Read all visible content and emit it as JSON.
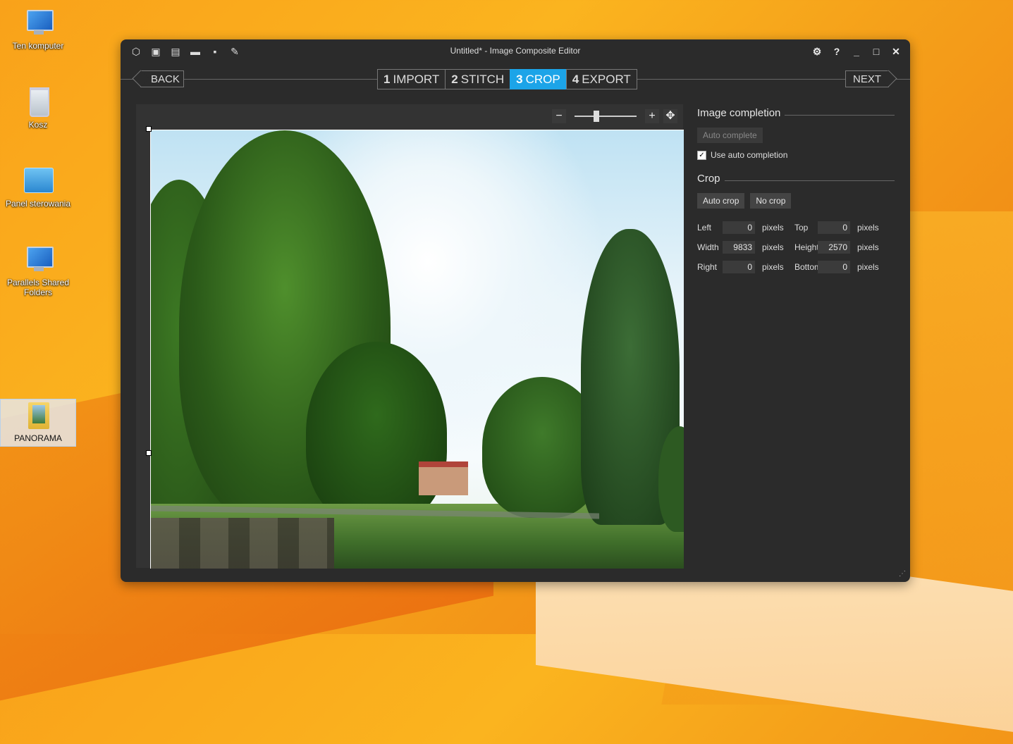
{
  "desktop": {
    "icons": [
      {
        "label": "Ten komputer"
      },
      {
        "label": "Kosz"
      },
      {
        "label": "Panel sterowania"
      },
      {
        "label": "Parallels Shared Folders"
      },
      {
        "label": "PANORAMA"
      }
    ]
  },
  "window": {
    "title": "Untitled* - Image Composite Editor",
    "toolbar_icons": [
      "new-project-icon",
      "new-panorama-from-images-icon",
      "new-panorama-from-video-icon",
      "open-folder-icon",
      "save-icon",
      "save-as-icon"
    ],
    "controls": [
      "settings-icon",
      "help-icon",
      "minimize-icon",
      "maximize-icon",
      "close-icon"
    ],
    "controls_glyphs": {
      "settings": "⚙",
      "help": "?",
      "minimize": "_",
      "maximize": "□",
      "close": "✕"
    }
  },
  "nav": {
    "back": "BACK",
    "next": "NEXT",
    "steps": [
      {
        "num": "1",
        "label": "IMPORT"
      },
      {
        "num": "2",
        "label": "STITCH"
      },
      {
        "num": "3",
        "label": "CROP"
      },
      {
        "num": "4",
        "label": "EXPORT"
      }
    ],
    "active_step": 3
  },
  "zoom": {
    "minus": "−",
    "plus": "+",
    "level": 0.3
  },
  "panel": {
    "image_completion": {
      "title": "Image completion",
      "auto_complete": "Auto complete",
      "use_auto_completion": "Use auto completion",
      "checked": true
    },
    "crop": {
      "title": "Crop",
      "auto_crop": "Auto crop",
      "no_crop": "No crop",
      "unit": "pixels",
      "left_label": "Left",
      "left": "0",
      "top_label": "Top",
      "top": "0",
      "width_label": "Width",
      "width": "9833",
      "height_label": "Height",
      "height": "2570",
      "right_label": "Right",
      "right": "0",
      "bottom_label": "Bottom",
      "bottom": "0"
    }
  }
}
